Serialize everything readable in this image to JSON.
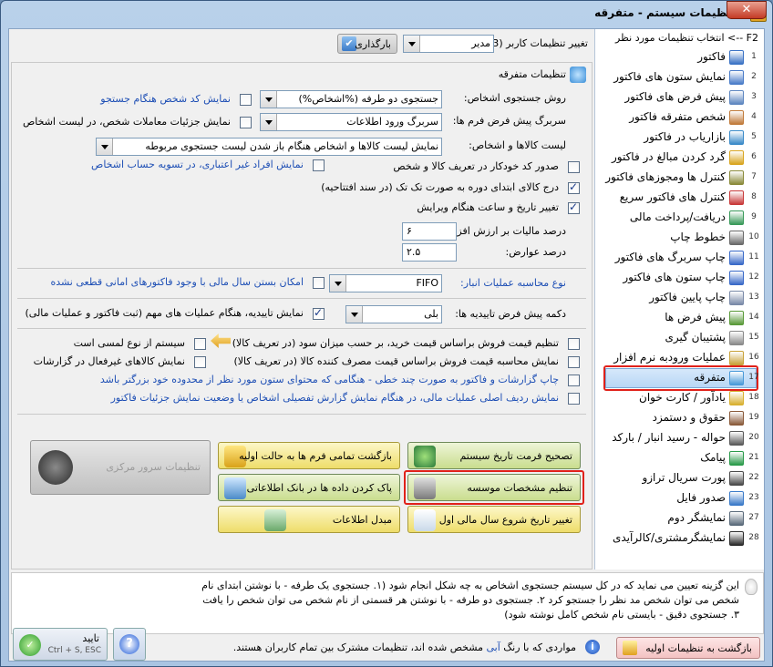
{
  "window": {
    "title": "تنظیمات سیستم - متفرقه",
    "close": "✕"
  },
  "header": {
    "user_settings_label": "تغییر تنظیمات کاربر (F3):",
    "user_value": "مدیر",
    "load_button": "بارگذاری",
    "sidebar_heading": "F2 --> انتخاب تنظیمات مورد نظر"
  },
  "sidebar": {
    "items": [
      {
        "num": "1",
        "label": "فاکتور",
        "color": "#3a72c4"
      },
      {
        "num": "2",
        "label": "نمایش ستون های فاکتور",
        "color": "#4a7cc8"
      },
      {
        "num": "3",
        "label": "پیش فرض های فاکتور",
        "color": "#5d86c0"
      },
      {
        "num": "4",
        "label": "شخص متفرقه فاکتور",
        "color": "#c07a3a"
      },
      {
        "num": "5",
        "label": "بازاریاب در فاکتور",
        "color": "#3a8ac8"
      },
      {
        "num": "6",
        "label": "گرد کردن مبالغ در فاکتور",
        "color": "#d8a520"
      },
      {
        "num": "7",
        "label": "کنترل ها ومجوزهای فاکتور",
        "color": "#8a8a3a"
      },
      {
        "num": "8",
        "label": "کنترل های فاکتور سریع",
        "color": "#c83a3a"
      },
      {
        "num": "9",
        "label": "دریافت/پرداخت مالی",
        "color": "#3a9a5a"
      },
      {
        "num": "10",
        "label": "خطوط چاپ",
        "color": "#6a6a6a"
      },
      {
        "num": "11",
        "label": "چاپ سربرگ های فاکتور",
        "color": "#3a6ac8"
      },
      {
        "num": "12",
        "label": "چاپ ستون های فاکتور",
        "color": "#3a6ac8"
      },
      {
        "num": "13",
        "label": "چاپ پایین فاکتور",
        "color": "#7a8aa8"
      },
      {
        "num": "14",
        "label": "پیش فرض ها",
        "color": "#5a9a3a"
      },
      {
        "num": "15",
        "label": "پشتیبان گیری",
        "color": "#8a8a8a"
      },
      {
        "num": "16",
        "label": "عملیات ورودبه نرم افزار",
        "color": "#c8a23a"
      },
      {
        "num": "17",
        "label": "متفرقه",
        "color": "#4a9ad8",
        "selected": true
      },
      {
        "num": "18",
        "label": "یادآور / کارت خوان",
        "color": "#d8b030"
      },
      {
        "num": "19",
        "label": "حقوق و دستمزد",
        "color": "#8a5a3a"
      },
      {
        "num": "20",
        "label": "حواله - رسید انبار / بارکد",
        "color": "#5a5a5a"
      },
      {
        "num": "21",
        "label": "پیامک",
        "color": "#2a9a4a"
      },
      {
        "num": "22",
        "label": "پورت سریال ترازو",
        "color": "#4a4a4a"
      },
      {
        "num": "23",
        "label": "صدور فایل",
        "color": "#3a7ac8"
      },
      {
        "num": "27",
        "label": "نمایشگر دوم",
        "color": "#5a6a7a"
      },
      {
        "num": "28",
        "label": "نمایشگرمشتری/کالرآیدی",
        "color": "#2a2a2a"
      }
    ]
  },
  "panel": {
    "title": "تنظیمات متفرقه",
    "search_label": "روش جستجوی اشخاص:",
    "search_value": "جستجوی دو طرفه (%اشخاص%)",
    "show_code_label": "نمایش کد شخص هنگام جستجو",
    "form_header_label": "سربرگ پیش فرض فرم ها:",
    "form_header_value": "سربرگ ورود اطلاعات",
    "show_person_details_label": "نمایش جزئیات معاملات شخص، در لیست اشخاص",
    "goods_list_label": "لیست کالاها و اشخاص:",
    "goods_list_value": "نمایش لیست کالاها و اشخاص هنگام باز شدن لیست جستجوی مربوطه",
    "auto_code_label": "صدور کد خودکار در تعریف کالا و شخص",
    "inactive_persons_label": "نمایش افراد غیر اعتباری، در تسویه حساب اشخاص",
    "single_goods_label": "درج کالای ابتدای دوره به صورت تک تک (در سند افتتاحیه)",
    "edit_datetime_label": "تغییر تاریخ و ساعت هنگام ویرایش",
    "vat_label": "درصد مالیات بر ارزش افزوده:",
    "vat_value": "۶",
    "duties_label": "درصد عوارض:",
    "duties_value": "۲.۵",
    "inventory_method_label": "نوع محاسبه عملیات انبار:",
    "inventory_method_value": "FIFO",
    "close_year_label": "امکان بستن سال مالی با وجود فاکتورهای امانی قطعی نشده",
    "confirm_default_label": "دکمه پیش فرض تاییدیه ها:",
    "confirm_default_value": "بلی",
    "show_confirm_label": "نمایش تاییدیه، هنگام عملیات های مهم (ثبت فاکتور و عملیات مالی)",
    "price_purchase_label": "تنظیم قیمت فروش براساس قیمت خرید، بر حسب میزان سود (در تعریف کالا)",
    "touch_label": "سیستم از نوع لمسی است",
    "price_consumer_label": "نمایش محاسبه قیمت فروش براساس قیمت مصرف کننده کالا (در تعریف کالا)",
    "inactive_goods_label": "نمایش کالاهای غیرفعال در گزارشات",
    "print_multiline_label": "چاپ گزارشات و فاکتور به صورت چند خطی - هنگامی که محتوای ستون مورد نظر از محدوده خود بزرگتر باشد",
    "show_row_label": "نمایش ردیف اصلی عملیات مالی، در هنگام نمایش گزارش تفصیلی اشخاص یا وضعیت نمایش جزئیات فاکتور"
  },
  "actions": {
    "date_format": "تصحیح فرمت تاریخ سیستم",
    "reset_forms": "بازگشت تمامی فرم ها به حالت اولیه",
    "institution": "تنظیم مشخصات موسسه",
    "clean_db": "پاک کردن داده ها در بانک اطلاعاتی",
    "start_date": "تغییر تاریخ شروع سال مالی اول",
    "converter": "مبدل اطلاعات",
    "central_server": "تنظیمات سرور مرکزی"
  },
  "help": {
    "text": "این گزینه تعیین می نماید که در کل سیستم جستجوی اشخاص به چه شکل انجام شود (۱. جستجوی یک طرفه - با نوشتن ابتدای نام شخص می توان شخص مد نظر را جستجو کرد ۲. جستجوی دو طرفه - با نوشتن هر قسمتی از نام شخص می توان شخص را یافت ۳. جستجوی دقیق - بایستی نام شخص کامل نوشته شود)"
  },
  "footer": {
    "reset_button": "بازگشت به تنظیمات اولیه",
    "note_prefix": "مواردی که با رنگ",
    "note_blue": "آبی",
    "note_suffix": "مشخص شده اند، تنظیمات مشترک بین تمام کاربران هستند.",
    "confirm_label": "تایید",
    "confirm_shortcut": "Ctrl + S, ESC",
    "help_button": "?"
  }
}
